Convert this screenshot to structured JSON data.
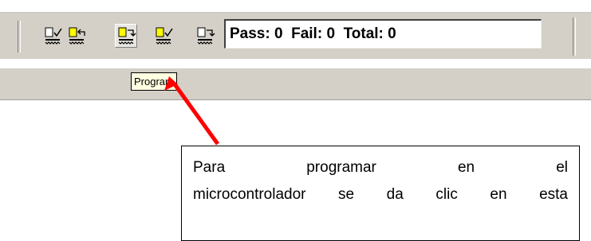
{
  "toolbar": {
    "buttons": [
      {
        "name": "blank-check"
      },
      {
        "name": "read"
      },
      {
        "name": "program"
      },
      {
        "name": "verify"
      },
      {
        "name": "erase"
      }
    ],
    "counter_text": "Pass: 0  Fail: 0  Total: 0"
  },
  "tooltip": {
    "text": "Program"
  },
  "callout": {
    "line1": "Para programar en el",
    "line2": "microcontrolador  se da clic en esta"
  },
  "colors": {
    "toolbar_bg": "#d4d0c8",
    "tooltip_bg": "#ffffe1",
    "chip_yellow": "#ffff00",
    "arrow_red": "#ff0000"
  }
}
